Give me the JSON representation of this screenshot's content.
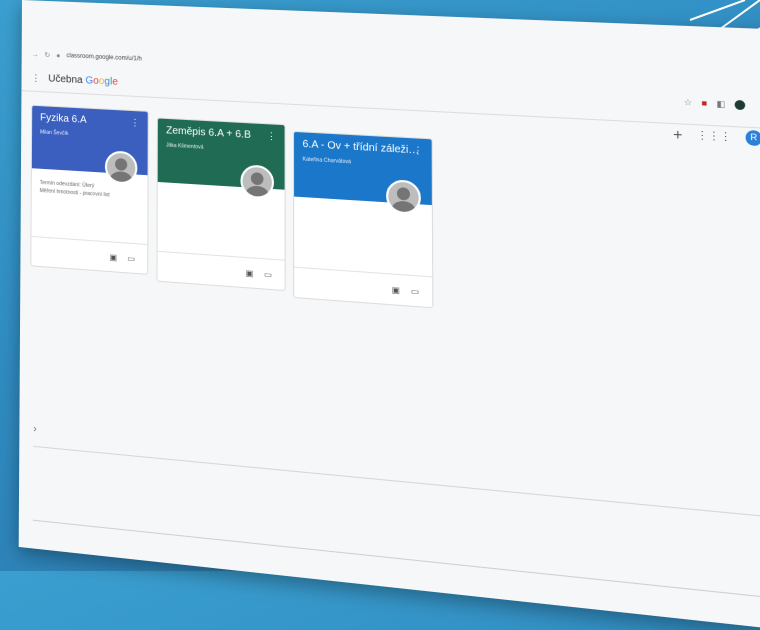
{
  "browser": {
    "url": "classroom.google.com/u/1/h"
  },
  "app": {
    "name_prefix": "Učebna",
    "google": [
      "G",
      "o",
      "o",
      "g",
      "l",
      "e"
    ]
  },
  "header_icons": [
    "star-icon",
    "extension-icon",
    "extension-icon",
    "profile-avatar-icon"
  ],
  "account_initial": "R",
  "cards": [
    {
      "title": "Fyzika 6.A",
      "teacher": "Milan Ševčík",
      "lines": [
        "Termín odevzdání: Úterý",
        "Měření hmotnosti - pracovní list"
      ],
      "color": "#3b5fbf"
    },
    {
      "title": "Zeměpis 6.A + 6.B",
      "teacher": "Jitka Klimentová",
      "lines": [],
      "color": "#1f6b53"
    },
    {
      "title": "6.A - Ov + třídní záleži…",
      "teacher": "Kateřina Charvátová",
      "lines": [],
      "color": "#1b77c9"
    }
  ]
}
